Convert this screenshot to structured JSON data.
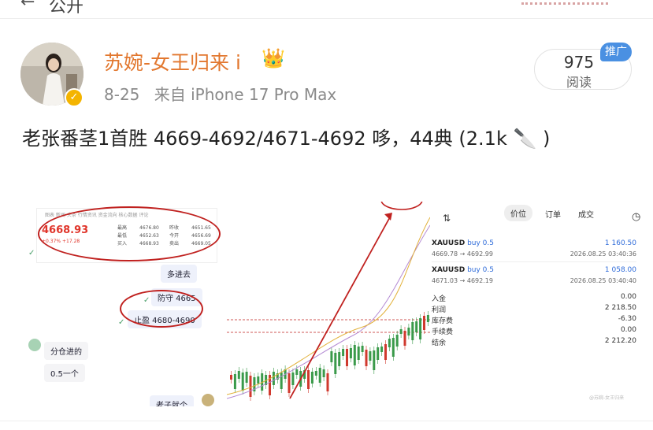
{
  "topbar": {
    "back_label": "←",
    "crumb_label": "公开"
  },
  "post": {
    "username": "苏婉-女王归来 i",
    "crown": "👑",
    "date": "8-25",
    "source": "来自 iPhone 17 Pro Max",
    "read_count": "975",
    "read_label": "阅读",
    "promo_label": "推广",
    "verified_mark": "✓",
    "text": "老张番茎1首胜 4669-4692/4671-4692 哆，44典 (2.1k 🔪 )"
  },
  "chat": {
    "quote": {
      "tabs": "图表  新闻  头条  行情资讯  资金流向  核心数据  评论",
      "price": "4668.93",
      "change": "+0.37%  +17.28",
      "col1": "最高\n最低\n买入",
      "col2": "4676.80\n4652.63\n4668.93",
      "col3": "昨收\n今开\n卖出",
      "col4": "4651.65\n4656.69\n4669.05"
    },
    "messages": [
      {
        "text": "多进去"
      },
      {
        "text": "防守 4665"
      },
      {
        "text": "止盈 4680-4690"
      },
      {
        "text": "分仓进的"
      },
      {
        "text": "0.5一个"
      },
      {
        "text": "老子就个"
      }
    ]
  },
  "trade": {
    "tabs": [
      "价位",
      "订单",
      "成交"
    ],
    "positions": [
      {
        "symbol": "XAUUSD",
        "side": "buy 0.5",
        "profit": "1 160.50",
        "range": "4669.78 → 4692.99",
        "time": "2026.08.25 03:40:36"
      },
      {
        "symbol": "XAUUSD",
        "side": "buy 0.5",
        "profit": "1 058.00",
        "range": "4671.03 → 4692.19",
        "time": "2026.08.25 03:40:40"
      }
    ],
    "summary": [
      {
        "label": "入金",
        "value": "0.00"
      },
      {
        "label": "利润",
        "value": "2 218.50"
      },
      {
        "label": "库存费",
        "value": "-6.30"
      },
      {
        "label": "手续费",
        "value": "0.00"
      },
      {
        "label": "结余",
        "value": "2 212.20"
      }
    ],
    "watermark": "@苏婉-女王归来"
  }
}
